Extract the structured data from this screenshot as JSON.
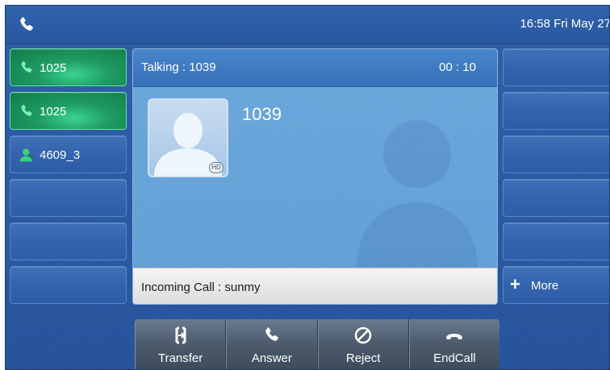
{
  "status_bar": {
    "time_text": "16:58 Fri May 27"
  },
  "line_keys": [
    {
      "label": "1025",
      "icon": "phone-icon",
      "active": true
    },
    {
      "label": "1025",
      "icon": "phone-icon",
      "active": true
    },
    {
      "label": "4609_3",
      "icon": "contact-icon",
      "active": false
    },
    {
      "label": "",
      "active": false
    },
    {
      "label": "",
      "active": false
    },
    {
      "label": "",
      "active": false
    }
  ],
  "right_keys": [
    {
      "label": ""
    },
    {
      "label": ""
    },
    {
      "label": ""
    },
    {
      "label": ""
    },
    {
      "label": ""
    },
    {
      "label": "More",
      "icon": "plus-icon"
    }
  ],
  "call": {
    "state": "Talking : 1039",
    "timer": "00 : 10",
    "contact_number": "1039",
    "hd_badge": "HD",
    "incoming": "Incoming Call : sunmy"
  },
  "softkeys": [
    {
      "label": "Transfer",
      "icon": "transfer-icon"
    },
    {
      "label": "Answer",
      "icon": "answer-icon"
    },
    {
      "label": "Reject",
      "icon": "reject-icon"
    },
    {
      "label": "EndCall",
      "icon": "endcall-icon"
    }
  ],
  "colors": {
    "background": "#2a5aa4",
    "active_line": "#1e9b63",
    "call_panel": "#6aa6da",
    "softkey": "#4d5c6e"
  }
}
